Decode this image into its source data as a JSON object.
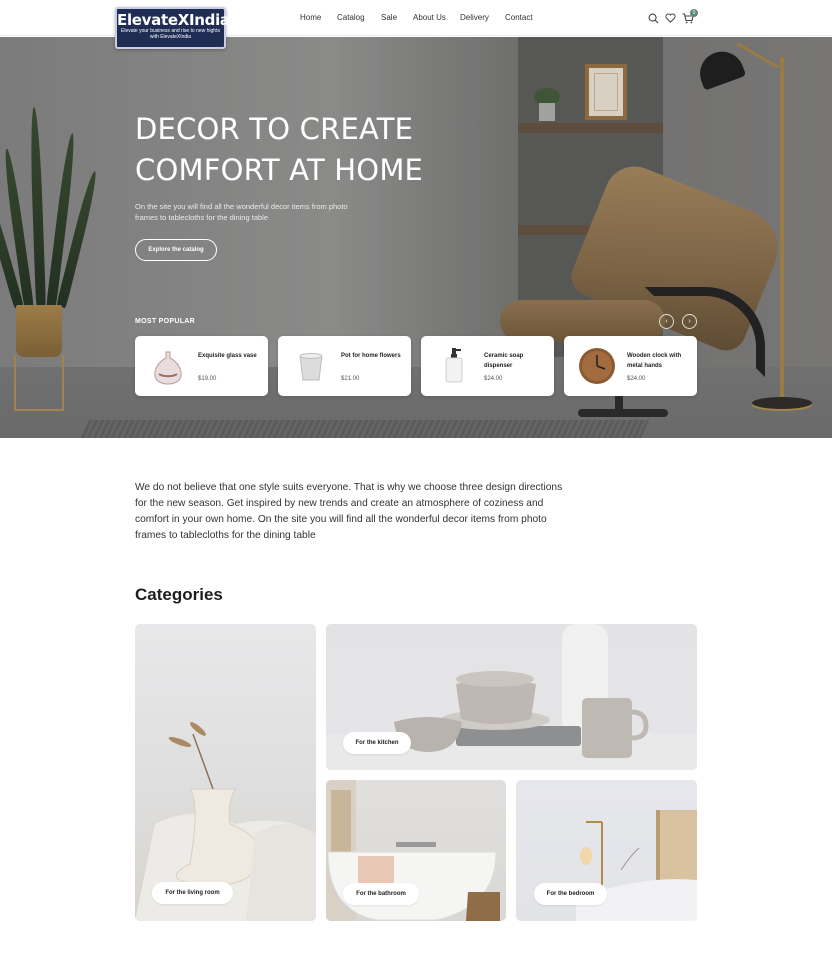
{
  "brand": {
    "name": "ElevateXIndia",
    "tagline": "Elevate your business and rise to new hights with ElevateXIndia"
  },
  "nav": [
    "Home",
    "Catalog",
    "Sale",
    "About Us",
    "Delivery",
    "Contact"
  ],
  "cart_count": "0",
  "hero": {
    "title": "DECOR TO CREATE\nCOMFORT AT HOME",
    "subtitle": "On the site you will find all the wonderful decor items from photo frames to tablecloths for the dining table",
    "cta": "Explore the catalog",
    "popular_label": "MOST POPULAR",
    "prev_symbol": "‹",
    "next_symbol": "›"
  },
  "popular": [
    {
      "name": "Exquisite glass vase",
      "price": "$19.00",
      "icon": "vase-icon"
    },
    {
      "name": "Pot for home flowers",
      "price": "$21.00",
      "icon": "pot-icon"
    },
    {
      "name": "Ceramic soap dispenser",
      "price": "$24.00",
      "icon": "soap-dispenser-icon"
    },
    {
      "name": "Wooden clock with metal hands",
      "price": "$24.00",
      "icon": "clock-icon"
    }
  ],
  "intro": "We do not believe that one style suits everyone. That is why we choose three design directions for the new season. Get inspired by new trends and create an atmosphere of coziness and comfort in your own home. On the site you will find all the wonderful decor items from photo frames to tablecloths for the dining table",
  "categories": {
    "title": "Categories",
    "items": [
      {
        "label": "For the living room"
      },
      {
        "label": "For the kitchen"
      },
      {
        "label": "For the bathroom"
      },
      {
        "label": "For the bedroom"
      }
    ]
  },
  "colors": {
    "accent": "#5d8a78",
    "logo_bg": "#1f2d55"
  }
}
